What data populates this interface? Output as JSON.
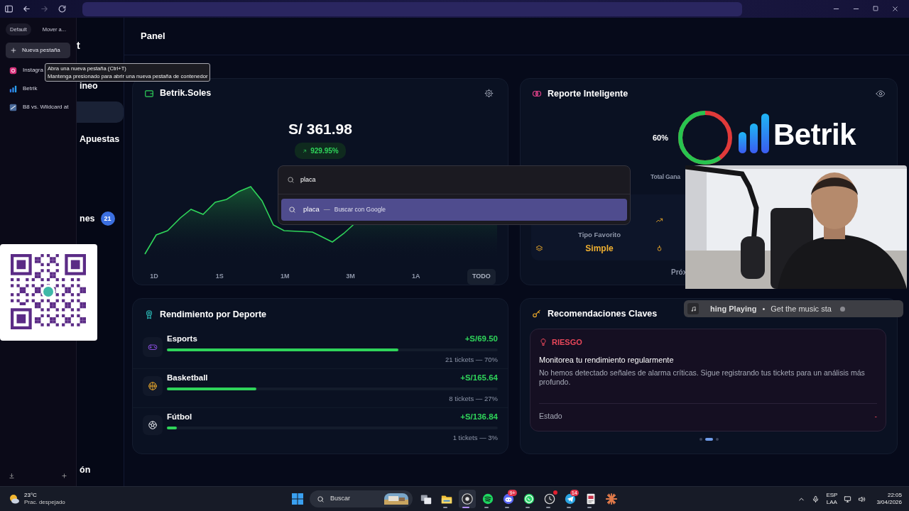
{
  "browser": {
    "forward": {
      "disabled": true
    }
  },
  "tab_panel": {
    "chips": [
      {
        "label": "Default",
        "selected": true
      },
      {
        "label": "Mover a...",
        "selected": false
      }
    ],
    "new_tab": {
      "label": "Nueva pestaña",
      "hovered": true
    },
    "tabs": [
      {
        "label": "Instagra",
        "kind": "instagram",
        "selected": false
      },
      {
        "label": "Betrik",
        "kind": "bars",
        "selected": false
      },
      {
        "label": "B8 vs. Wildcard at",
        "kind": "game",
        "selected": false
      }
    ]
  },
  "tooltip": {
    "lines": [
      "Abra una nueva pestaña (Ctrl+T)",
      "Mantenga presionado para abrir una nueva pestaña de contenedor"
    ]
  },
  "sidebar": {
    "brand": "t",
    "items": [
      {
        "label": "ineo",
        "selected": false
      },
      {
        "selected": true
      },
      {
        "label": "Apuestas",
        "selected": false
      },
      {
        "label": "nes",
        "badge": "21",
        "selected": false
      },
      {
        "label": "ón",
        "selected": false
      }
    ]
  },
  "header": {
    "title": "Panel"
  },
  "balance_card": {
    "title": "Betrik.Soles",
    "amount": "S/ 361.98",
    "change": "929.95%",
    "ranges": [
      {
        "label": "1D",
        "selected": false
      },
      {
        "label": "1S",
        "selected": false
      },
      {
        "label": "1M",
        "selected": false
      },
      {
        "label": "3M",
        "selected": false
      },
      {
        "label": "1A",
        "selected": false
      },
      {
        "label": "TODO",
        "selected": true
      }
    ]
  },
  "report_card": {
    "title": "Reporte Inteligente",
    "percent": "60%",
    "level": 0.6,
    "total_label": "Total Gana",
    "favorite_label": "Tipo Favorito",
    "favorite_value": "Simple",
    "next_label": "Próx"
  },
  "logo": {
    "text": "Betrik"
  },
  "sports_card": {
    "title": "Rendimiento por Deporte",
    "sports": [
      {
        "name": "Esports",
        "kind": "esports",
        "amount": "+S/69.50",
        "level": 0.7,
        "detail": "21 tickets — 70%"
      },
      {
        "name": "Basketball",
        "kind": "basketball",
        "amount": "+S/165.64",
        "level": 0.27,
        "detail": "8 tickets — 27%"
      },
      {
        "name": "Fútbol",
        "kind": "football",
        "amount": "+S/136.84",
        "level": 0.03,
        "detail": "1 tickets — 3%"
      }
    ]
  },
  "recommendations_card": {
    "title": "Recomendaciones Claves",
    "tip": {
      "tag": "RIESGO",
      "title": "Monitorea tu rendimiento regularmente",
      "body": "No hemos detectado señales de alarma críticas. Sigue registrando tus tickets para un análisis más profundo.",
      "status_label": "Estado",
      "status_value": "-"
    },
    "dots": [
      {
        "selected": false
      },
      {
        "selected": true
      },
      {
        "selected": false
      }
    ]
  },
  "omnibox": {
    "value": "placa",
    "suggestion": {
      "query": "placa",
      "separator": "—",
      "action": "Buscar con Google",
      "selected": true
    }
  },
  "music": {
    "title": "hing Playing",
    "separator": "•",
    "subtitle": "Get the music sta"
  },
  "taskbar": {
    "weather": {
      "temp": "23°C",
      "desc": "Prac. despejado"
    },
    "search": "Buscar",
    "apps": [
      {
        "kind": "taskview",
        "open": false
      },
      {
        "kind": "folder",
        "open": true
      },
      {
        "kind": "record",
        "open": true,
        "active": true
      },
      {
        "kind": "music",
        "open": true
      },
      {
        "kind": "gamechat",
        "open": true,
        "badge": "9+"
      },
      {
        "kind": "phonechat",
        "open": true
      },
      {
        "kind": "timer",
        "open": true,
        "alert": true
      },
      {
        "kind": "plane",
        "open": true,
        "badge": "14"
      },
      {
        "kind": "document",
        "open": true
      },
      {
        "kind": "sunburst",
        "open": false
      }
    ],
    "lang": "ESP",
    "layout": "LAA",
    "time": "22:05",
    "date": "3/04/2026"
  }
}
